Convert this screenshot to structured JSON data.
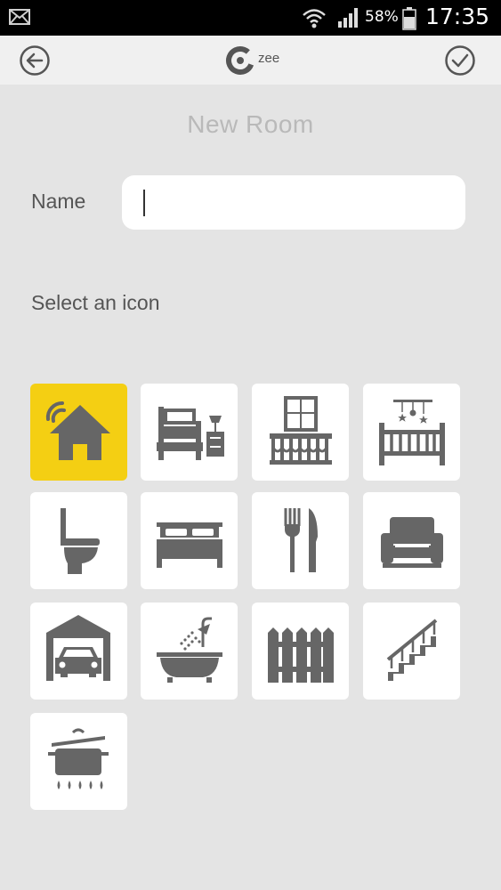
{
  "status_bar": {
    "battery": "58%",
    "time": "17:35"
  },
  "app_bar": {
    "logo_text": "zee",
    "back_icon": "arrow-left-circle-icon",
    "confirm_icon": "check-circle-icon"
  },
  "form": {
    "title": "New Room",
    "name_label": "Name",
    "name_value": "",
    "select_label": "Select an icon"
  },
  "icons": [
    {
      "name": "home-icon",
      "selected": true
    },
    {
      "name": "bedroom-nightstand-icon",
      "selected": false
    },
    {
      "name": "balcony-icon",
      "selected": false
    },
    {
      "name": "nursery-crib-icon",
      "selected": false
    },
    {
      "name": "toilet-icon",
      "selected": false
    },
    {
      "name": "double-bed-icon",
      "selected": false
    },
    {
      "name": "dining-fork-knife-icon",
      "selected": false
    },
    {
      "name": "armchair-icon",
      "selected": false
    },
    {
      "name": "garage-car-icon",
      "selected": false
    },
    {
      "name": "bathtub-shower-icon",
      "selected": false
    },
    {
      "name": "garden-fence-icon",
      "selected": false
    },
    {
      "name": "stairs-icon",
      "selected": false
    },
    {
      "name": "kitchen-pot-icon",
      "selected": false
    }
  ],
  "colors": {
    "selected_tile": "#f4cf13",
    "icon_gray": "#666666",
    "background": "#e4e4e4"
  }
}
